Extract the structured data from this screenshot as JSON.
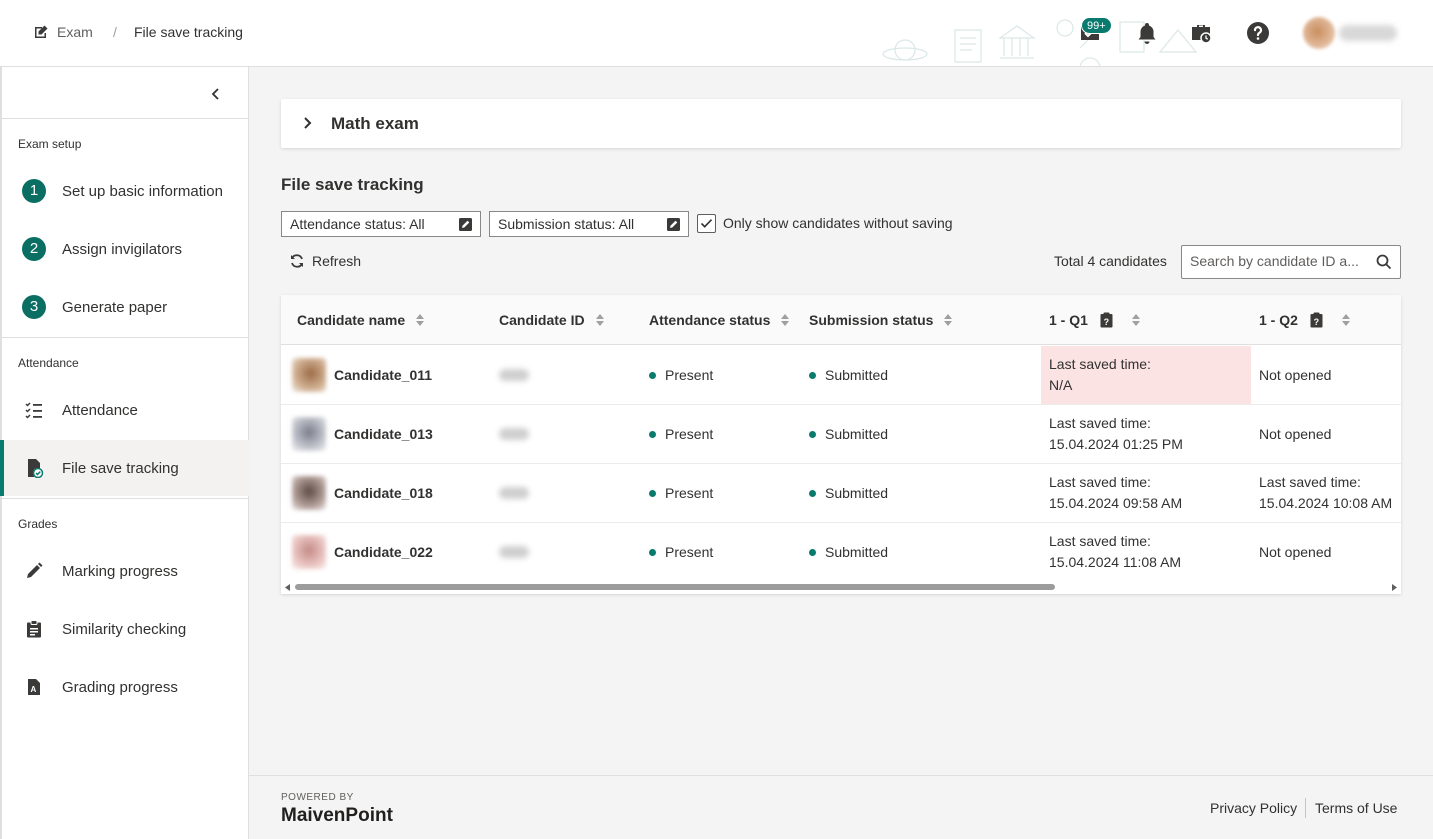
{
  "breadcrumb": {
    "home": "Exam",
    "separator": "/",
    "current": "File save tracking"
  },
  "topbar": {
    "notification_badge": "99+"
  },
  "sidebar": {
    "sections": [
      {
        "title": "Exam setup"
      },
      {
        "title": "Attendance"
      },
      {
        "title": "Grades"
      }
    ],
    "items": [
      {
        "label": "Set up basic information",
        "step": "1"
      },
      {
        "label": "Assign invigilators",
        "step": "2"
      },
      {
        "label": "Generate paper",
        "step": "3"
      },
      {
        "label": "Attendance",
        "icon": "checklist-icon"
      },
      {
        "label": "File save tracking",
        "icon": "file-check-icon",
        "active": true
      },
      {
        "label": "Marking progress",
        "icon": "pencil-icon"
      },
      {
        "label": "Similarity checking",
        "icon": "clipboard-icon"
      },
      {
        "label": "Grading progress",
        "icon": "grade-file-icon"
      }
    ]
  },
  "exam_card": {
    "title": "Math exam"
  },
  "main": {
    "title": "File save tracking",
    "filters": {
      "attendance": "Attendance status: All",
      "submission": "Submission status: All",
      "only_without_saving": "Only show candidates without saving",
      "only_without_saving_checked": true
    },
    "refresh_label": "Refresh",
    "total": "Total 4 candidates",
    "search_placeholder": "Search by candidate ID a..."
  },
  "table": {
    "columns": [
      "Candidate name",
      "Candidate ID",
      "Attendance status",
      "Submission status",
      "1 - Q1",
      "1 - Q2"
    ],
    "rows": [
      {
        "name": "Candidate_011",
        "attendance": "Present",
        "submission": "Submitted",
        "q1_label": "Last saved time:",
        "q1_value": "N/A",
        "q1_highlight": true,
        "q2_label": "Not opened",
        "q2_value": ""
      },
      {
        "name": "Candidate_013",
        "attendance": "Present",
        "submission": "Submitted",
        "q1_label": "Last saved time:",
        "q1_value": "15.04.2024 01:25 PM",
        "q1_highlight": false,
        "q2_label": "Not opened",
        "q2_value": ""
      },
      {
        "name": "Candidate_018",
        "attendance": "Present",
        "submission": "Submitted",
        "q1_label": "Last saved time:",
        "q1_value": "15.04.2024 09:58 AM",
        "q1_highlight": false,
        "q2_label": "Last saved time:",
        "q2_value": "15.04.2024 10:08 AM"
      },
      {
        "name": "Candidate_022",
        "attendance": "Present",
        "submission": "Submitted",
        "q1_label": "Last saved time:",
        "q1_value": "15.04.2024 11:08 AM",
        "q1_highlight": false,
        "q2_label": "Not opened",
        "q2_value": ""
      }
    ]
  },
  "footer": {
    "powered_by": "POWERED BY",
    "brand": "MaivenPoint",
    "privacy": "Privacy Policy",
    "terms": "Terms of Use"
  },
  "colors": {
    "accent": "#0a7a6e",
    "highlight": "#fce3e3"
  }
}
